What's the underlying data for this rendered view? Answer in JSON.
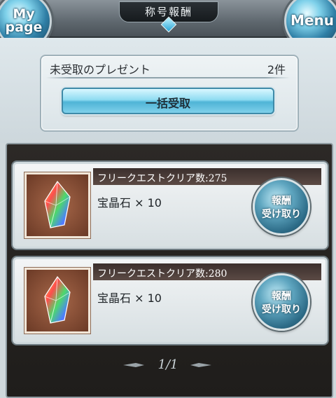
{
  "header": {
    "title": "称号報酬",
    "my_page_line1": "My",
    "my_page_line2": "page",
    "menu_label": "Menu"
  },
  "present": {
    "label": "未受取のプレゼント",
    "count": "2件",
    "bulk_button": "一括受取"
  },
  "rewards": [
    {
      "quest": "フリークエストクリア数:275",
      "item": "宝晶石 × 10",
      "claim_line1": "報酬",
      "claim_line2": "受け取り",
      "icon": "rainbow-crystal-icon"
    },
    {
      "quest": "フリークエストクリア数:280",
      "item": "宝晶石 × 10",
      "claim_line1": "報酬",
      "claim_line2": "受け取り",
      "icon": "rainbow-crystal-icon"
    }
  ],
  "pagination": {
    "label": "1/1"
  },
  "colors": {
    "accent": "#4fb4d6",
    "panel": "#24211f",
    "card": "#e8edef"
  }
}
